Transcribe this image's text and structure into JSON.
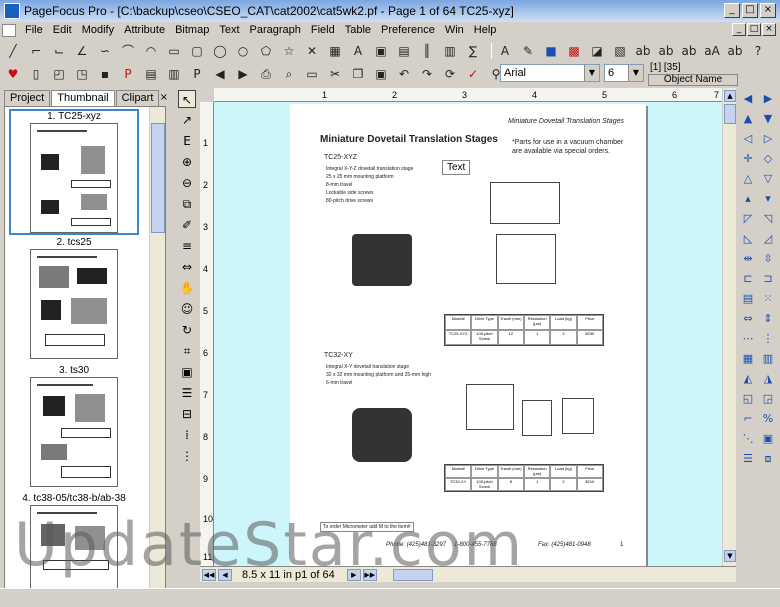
{
  "window": {
    "title": "PageFocus Pro - [C:\\backup\\cseo\\CSEO_CAT\\cat2002\\cat5wk2.pf - Page 1 of 64 TC25-xyz]",
    "minimize_label": "_",
    "maximize_label": "□",
    "close_label": "×"
  },
  "menubar": {
    "items": [
      "File",
      "Edit",
      "Modify",
      "Attribute",
      "Bitmap",
      "Text",
      "Paragraph",
      "Field",
      "Table",
      "Preference",
      "Win",
      "Help"
    ]
  },
  "format_toolbar": {
    "font": "Arial",
    "size": "6",
    "field_info": "[1] [35]",
    "object_name_label": "Object Name"
  },
  "left_panel": {
    "tabs": [
      "Project",
      "Thumbnail",
      "Clipart"
    ],
    "active_tab": "Thumbnail",
    "close_label": "×",
    "thumbnails": [
      {
        "label": "1. TC25-xyz"
      },
      {
        "label": "2. tcs25"
      },
      {
        "label": "3. ts30"
      },
      {
        "label": "4. tc38-05/tc38-b/ab-38"
      }
    ]
  },
  "rulers": {
    "horizontal": [
      "1",
      "2",
      "3",
      "4",
      "5",
      "6",
      "7"
    ],
    "vertical": [
      "1",
      "2",
      "3",
      "4",
      "5",
      "6",
      "7",
      "8",
      "9",
      "10",
      "11"
    ]
  },
  "page": {
    "header_right": "Miniature Dovetail Translation Stages",
    "title": "Miniature Dovetail Translation Stages",
    "note": "*Parts for use in a vacuum chamber are available via special orders.",
    "section1": "TC25-XYZ",
    "bullets1": [
      "Integral X-Y-Z dovetail translation stage",
      "25 x 25 mm mounting platform",
      "8-mm travel",
      "Lockable side screws",
      "80-pitch drive screws"
    ],
    "text_box": "Text",
    "spec1_headers": [
      "Model#",
      "Drive Type",
      "Travel (mm)",
      "Resolution (µm)",
      "Load (kg)",
      "Price"
    ],
    "spec1_row": [
      "TC25-XYZ",
      "100-pitch Screw",
      "12",
      "1",
      "2",
      "$230"
    ],
    "section2": "TC32-XY",
    "bullets2": [
      "Integral X-Y dovetail translation stage",
      "32 x 32 mm mounting platform and 25-mm high",
      "6-mm travel"
    ],
    "spec2_headers": [
      "Model#",
      "Drive Type",
      "Travel (mm)",
      "Resolution (µm)",
      "Load (kg)",
      "Price"
    ],
    "spec2_row": [
      "TC32-XY",
      "100-pitch Screw",
      "8",
      "1",
      "2",
      "$210"
    ],
    "order_box": "To order Micrometer add M to the item#",
    "phone": "Phone: (425)481-3297",
    "phone2": "1-800-455-7788",
    "fax": "Fax: (425)481-0948",
    "page_number": "1"
  },
  "status": {
    "page_info": "8.5 x 11 in p1 of 64"
  },
  "watermark": "UpdateStar.com"
}
